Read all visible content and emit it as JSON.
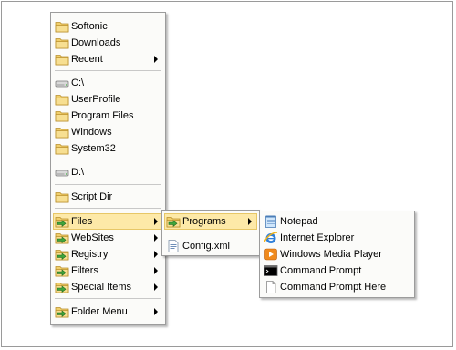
{
  "main_menu": {
    "items": [
      {
        "label": "Softonic",
        "icon": "folder-icon"
      },
      {
        "label": "Downloads",
        "icon": "folder-icon"
      },
      {
        "label": "Recent",
        "icon": "folder-icon",
        "submenu": true
      },
      {
        "label": "C:\\",
        "icon": "drive-icon"
      },
      {
        "label": "UserProfile",
        "icon": "folder-icon"
      },
      {
        "label": "Program Files",
        "icon": "folder-icon"
      },
      {
        "label": "Windows",
        "icon": "folder-icon"
      },
      {
        "label": "System32",
        "icon": "folder-icon"
      },
      {
        "label": "D:\\",
        "icon": "drive-icon"
      },
      {
        "label": "Script Dir",
        "icon": "folder-icon"
      },
      {
        "label": "Files",
        "icon": "folder-arrow-icon",
        "submenu": true,
        "highlighted": true
      },
      {
        "label": "WebSites",
        "icon": "folder-arrow-icon",
        "submenu": true
      },
      {
        "label": "Registry",
        "icon": "folder-arrow-icon",
        "submenu": true
      },
      {
        "label": "Filters",
        "icon": "folder-arrow-icon",
        "submenu": true
      },
      {
        "label": "Special Items",
        "icon": "folder-arrow-icon",
        "submenu": true
      },
      {
        "label": "Folder Menu",
        "icon": "folder-arrow-icon",
        "submenu": true
      }
    ]
  },
  "files_menu": {
    "items": [
      {
        "label": "Programs",
        "icon": "folder-arrow-icon",
        "submenu": true,
        "highlighted": true
      },
      {
        "label": "Config.xml",
        "icon": "xml-file-icon"
      }
    ]
  },
  "programs_menu": {
    "items": [
      {
        "label": "Notepad",
        "icon": "notepad-icon"
      },
      {
        "label": "Internet Explorer",
        "icon": "internet-explorer-icon"
      },
      {
        "label": "Windows Media Player",
        "icon": "media-player-icon"
      },
      {
        "label": "Command Prompt",
        "icon": "command-prompt-icon"
      },
      {
        "label": "Command Prompt Here",
        "icon": "document-icon"
      }
    ]
  },
  "colors": {
    "highlight_fill": "#fde9a8",
    "highlight_border": "#e7c767",
    "menu_background": "#fbfbf9"
  }
}
